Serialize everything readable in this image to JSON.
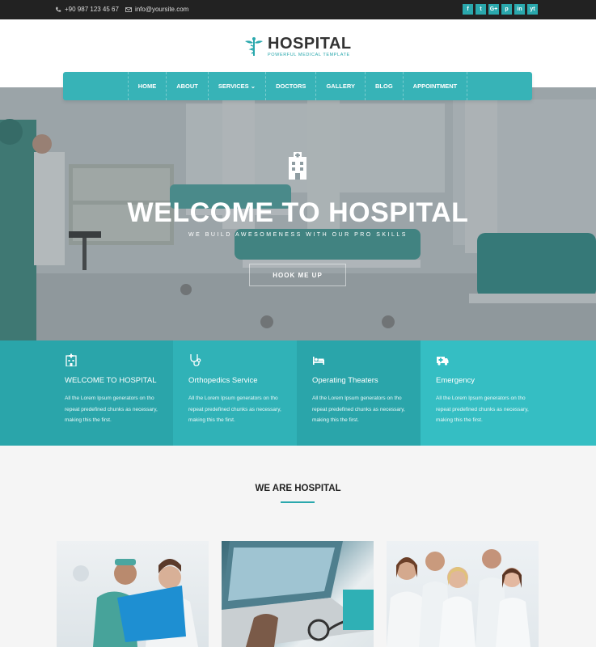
{
  "topbar": {
    "phone": "+90 987 123 45 67",
    "email": "info@yoursite.com",
    "socials": [
      "f",
      "t",
      "G+",
      "p",
      "in",
      "yt"
    ]
  },
  "header": {
    "logo_title": "HOSPITAL",
    "logo_tagline": "POWERFUL MEDICAL TEMPLATE"
  },
  "nav": {
    "items": [
      "HOME",
      "ABOUT",
      "SERVICES ⌄",
      "DOCTORS",
      "GALLERY",
      "BLOG",
      "APPOINTMENT"
    ]
  },
  "hero": {
    "title": "WELCOME TO HOSPITAL",
    "subtitle": "WE BUILD AWESOMENESS WITH OUR PRO SKILLS",
    "button": "HOOK ME UP"
  },
  "features": [
    {
      "title": "WELCOME TO HOSPITAL",
      "text": "All the Lorem Ipsum generators on tho repeat predefined chunks as necessary, making this the first.",
      "icon": "hospital-icon"
    },
    {
      "title": "Orthopedics Service",
      "text": "All the Lorem Ipsum generators on tho repeat predefined chunks as necessary, making this the first.",
      "icon": "stethoscope-icon"
    },
    {
      "title": "Operating Theaters",
      "text": "All the Lorem Ipsum generators on tho repeat predefined chunks as necessary, making this the first.",
      "icon": "bed-icon"
    },
    {
      "title": "Emergency",
      "text": "All the Lorem Ipsum generators on tho repeat predefined chunks as necessary, making this the first.",
      "icon": "ambulance-icon"
    }
  ],
  "about": {
    "heading": "WE ARE HOSPITAL"
  },
  "colors": {
    "accent": "#2aa8ad",
    "topbar": "#222222"
  }
}
